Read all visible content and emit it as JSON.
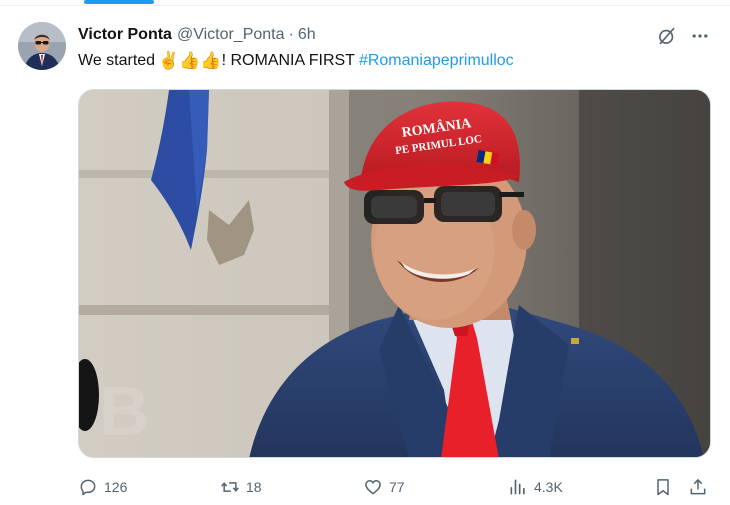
{
  "tweet": {
    "author_name": "Victor Ponta",
    "author_handle": "@Victor_Ponta",
    "separator": "·",
    "time": "6h",
    "text_prefix": "We started",
    "emojis": "✌️👍👍",
    "text_main": "! ROMANIA FIRST",
    "hashtag": "#Romaniapeprimulloc"
  },
  "media": {
    "cap_text_line1": "ROMÂNIA",
    "cap_text_line2": "PE PRIMUL LOC",
    "wall_letter": "B"
  },
  "actions": {
    "reply_count": "126",
    "repost_count": "18",
    "like_count": "77",
    "views_count": "4.3K"
  },
  "icons": {
    "reply": "speech-bubble-icon",
    "repost": "repost-arrows-icon",
    "like": "heart-icon",
    "views": "bar-chart-icon",
    "bookmark": "bookmark-icon",
    "share": "share-icon",
    "grok": "grok-icon",
    "more": "more-dots-icon"
  },
  "colors": {
    "link": "#1d9bf0",
    "secondary_text": "#536471",
    "cap_red": "#d8232a",
    "tie_red": "#e8202a",
    "suit_blue": "#2a3f6b"
  }
}
